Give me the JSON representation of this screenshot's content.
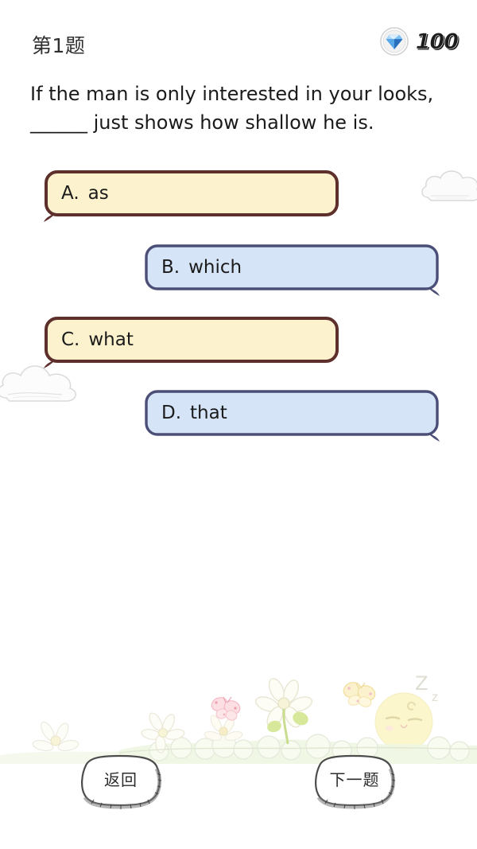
{
  "header": {
    "question_index_label": "第1题",
    "gem_icon": "diamond-gem-icon",
    "gem_count": "100"
  },
  "question": {
    "line1": "If the man is only interested in your looks,",
    "blank": "______",
    "line2_rest": " just shows how shallow he is."
  },
  "options": [
    {
      "letter": "A.",
      "text": "as",
      "style": "cream",
      "tail": "left"
    },
    {
      "letter": "B.",
      "text": "which",
      "style": "blue",
      "tail": "right"
    },
    {
      "letter": "C.",
      "text": "what",
      "style": "cream",
      "tail": "left"
    },
    {
      "letter": "D.",
      "text": "that",
      "style": "blue",
      "tail": "right"
    }
  ],
  "buttons": {
    "back_label": "返回",
    "next_label": "下一题"
  },
  "decorations": {
    "cloud_right_name": "cloud-decoration",
    "cloud_left_name": "cloud-decoration",
    "sleeping_character": "sleeping-face-icon",
    "sleep_z_big": "Z",
    "sleep_z_small": "z",
    "butterfly": "butterfly-icon",
    "flower": "daisy-flower-icon"
  },
  "colors": {
    "page_background": "#ffffff",
    "cream_fill": "#fcf2ce",
    "cream_border": "#5e302c",
    "blue_fill": "#d5e4f7",
    "blue_border": "#4b4f77",
    "text": "#1b1b1b",
    "gem_blue": "#4ba3e8",
    "scenery_green": "#e8f2d8",
    "scenery_yellow": "#f7f2cd"
  }
}
